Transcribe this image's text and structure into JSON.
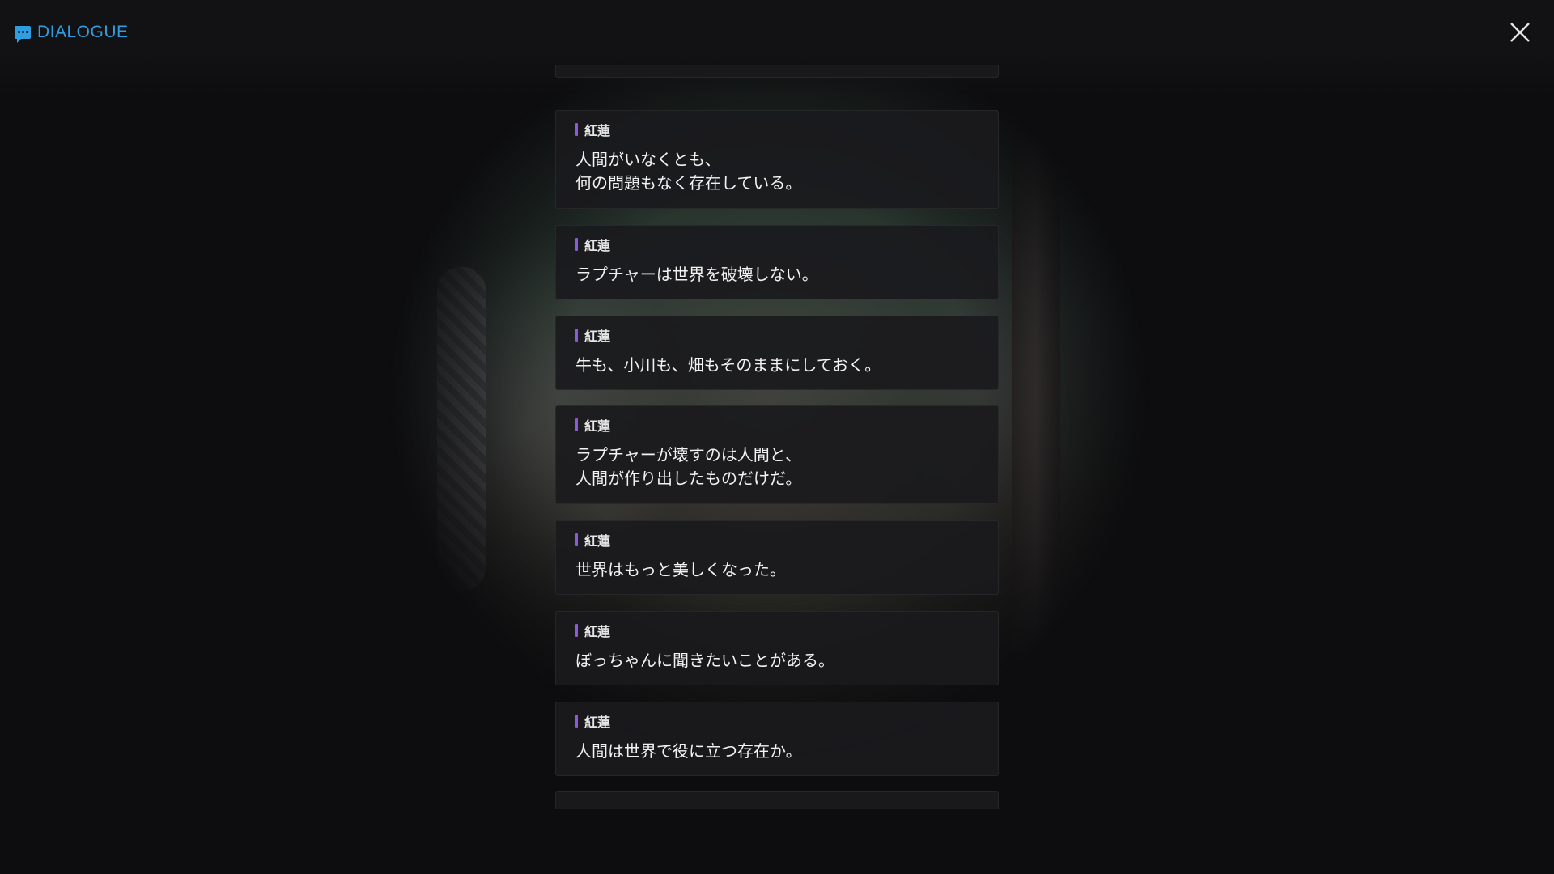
{
  "header": {
    "title": "DIALOGUE",
    "accent_color": "#2f9ee0",
    "icon": "chat-bubble-icon",
    "close_icon": "close-icon"
  },
  "dialogue": [
    {
      "speaker": "紅蓮",
      "text": "人間がいなくとも、\n何の問題もなく存在している。"
    },
    {
      "speaker": "紅蓮",
      "text": "ラプチャーは世界を破壊しない。"
    },
    {
      "speaker": "紅蓮",
      "text": "牛も、小川も、畑もそのままにしておく。"
    },
    {
      "speaker": "紅蓮",
      "text": "ラプチャーが壊すのは人間と、\n人間が作り出したものだけだ。"
    },
    {
      "speaker": "紅蓮",
      "text": "世界はもっと美しくなった。"
    },
    {
      "speaker": "紅蓮",
      "text": "ぼっちゃんに聞きたいことがある。"
    },
    {
      "speaker": "紅蓮",
      "text": "人間は世界で役に立つ存在か。"
    }
  ],
  "speaker_bar_color": "#8a5cd9"
}
